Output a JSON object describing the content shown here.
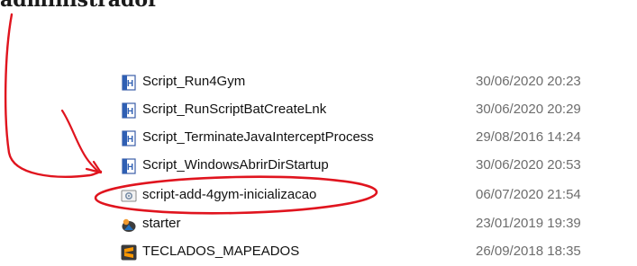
{
  "heading": {
    "text": "administrador"
  },
  "files": [
    {
      "name": "Script_Run4Gym",
      "modified": "30/06/2020 20:23",
      "icon": "hta-script-icon"
    },
    {
      "name": "Script_RunScriptBatCreateLnk",
      "modified": "30/06/2020 20:29",
      "icon": "hta-script-icon"
    },
    {
      "name": "Script_TerminateJavaInterceptProcess",
      "modified": "29/08/2016 14:24",
      "icon": "hta-script-icon"
    },
    {
      "name": "Script_WindowsAbrirDirStartup",
      "modified": "30/06/2020 20:53",
      "icon": "hta-script-icon"
    },
    {
      "name": "script-add-4gym-inicializacao",
      "modified": "06/07/2020 21:54",
      "icon": "settings-file-icon"
    },
    {
      "name": "starter",
      "modified": "23/01/2019 19:39",
      "icon": "starter-app-icon"
    },
    {
      "name": "TECLADOS_MAPEADOS",
      "modified": "26/09/2018 18:35",
      "icon": "sublime-file-icon"
    }
  ],
  "annotation": {
    "color": "#e0141e",
    "highlighted_file": "script-add-4gym-inicializacao"
  }
}
